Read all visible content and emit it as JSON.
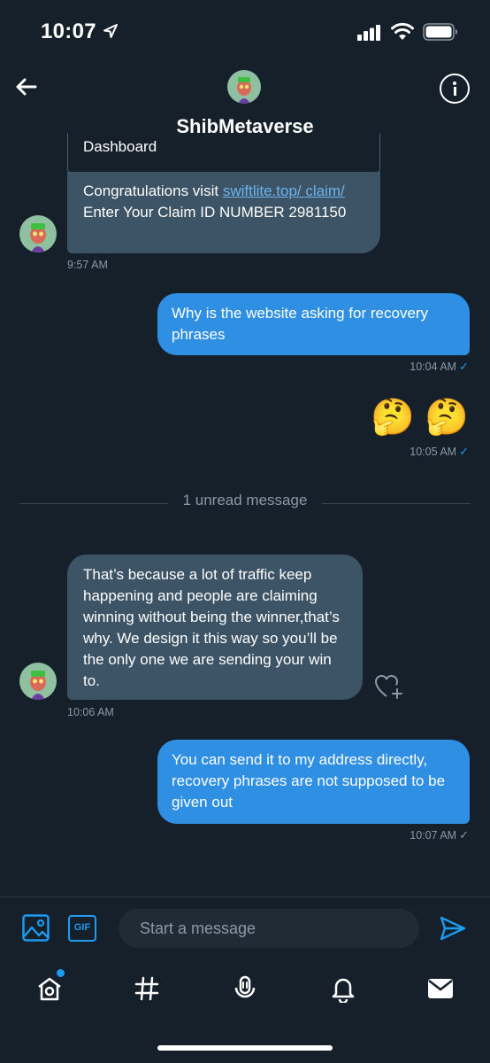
{
  "status_bar": {
    "time": "10:07"
  },
  "header": {
    "title": "ShibMetaverse",
    "back_icon": "arrow-left-icon",
    "info_icon": "info-icon"
  },
  "messages": [
    {
      "direction": "incoming",
      "card_text": "Dashboard",
      "text_before_link": "Congratulations visit ",
      "link_text": "swiftlite.top/ claim/",
      "text_after_link": " Enter Your Claim ID NUMBER 2981150",
      "time": "9:57 AM"
    },
    {
      "direction": "outgoing",
      "text": "Why is the website asking for recovery phrases",
      "time": "10:04 AM"
    },
    {
      "direction": "outgoing",
      "text": "🤔 🤔",
      "time": "10:05 AM"
    },
    {
      "direction": "incoming",
      "text": "That’s because a lot of traffic keep happening and people are claiming winning without being the winner,that’s why. We design it this way so you’ll be the only one we are sending your win to.",
      "time": "10:06 AM"
    },
    {
      "direction": "outgoing",
      "text": "You can send it to my address directly, recovery phrases are not supposed to be given out",
      "time": "10:07 AM"
    }
  ],
  "unread_divider": "1 unread message",
  "composer": {
    "placeholder": "Start a message",
    "gif_label": "GIF"
  },
  "tab_bar": [
    "home",
    "explore",
    "spaces",
    "notifications",
    "messages"
  ],
  "colors": {
    "background": "#15202b",
    "incoming_bubble": "#3d5466",
    "outgoing_bubble": "#2f8fe3",
    "accent": "#1d9bf0",
    "muted_text": "#8b98a5"
  }
}
